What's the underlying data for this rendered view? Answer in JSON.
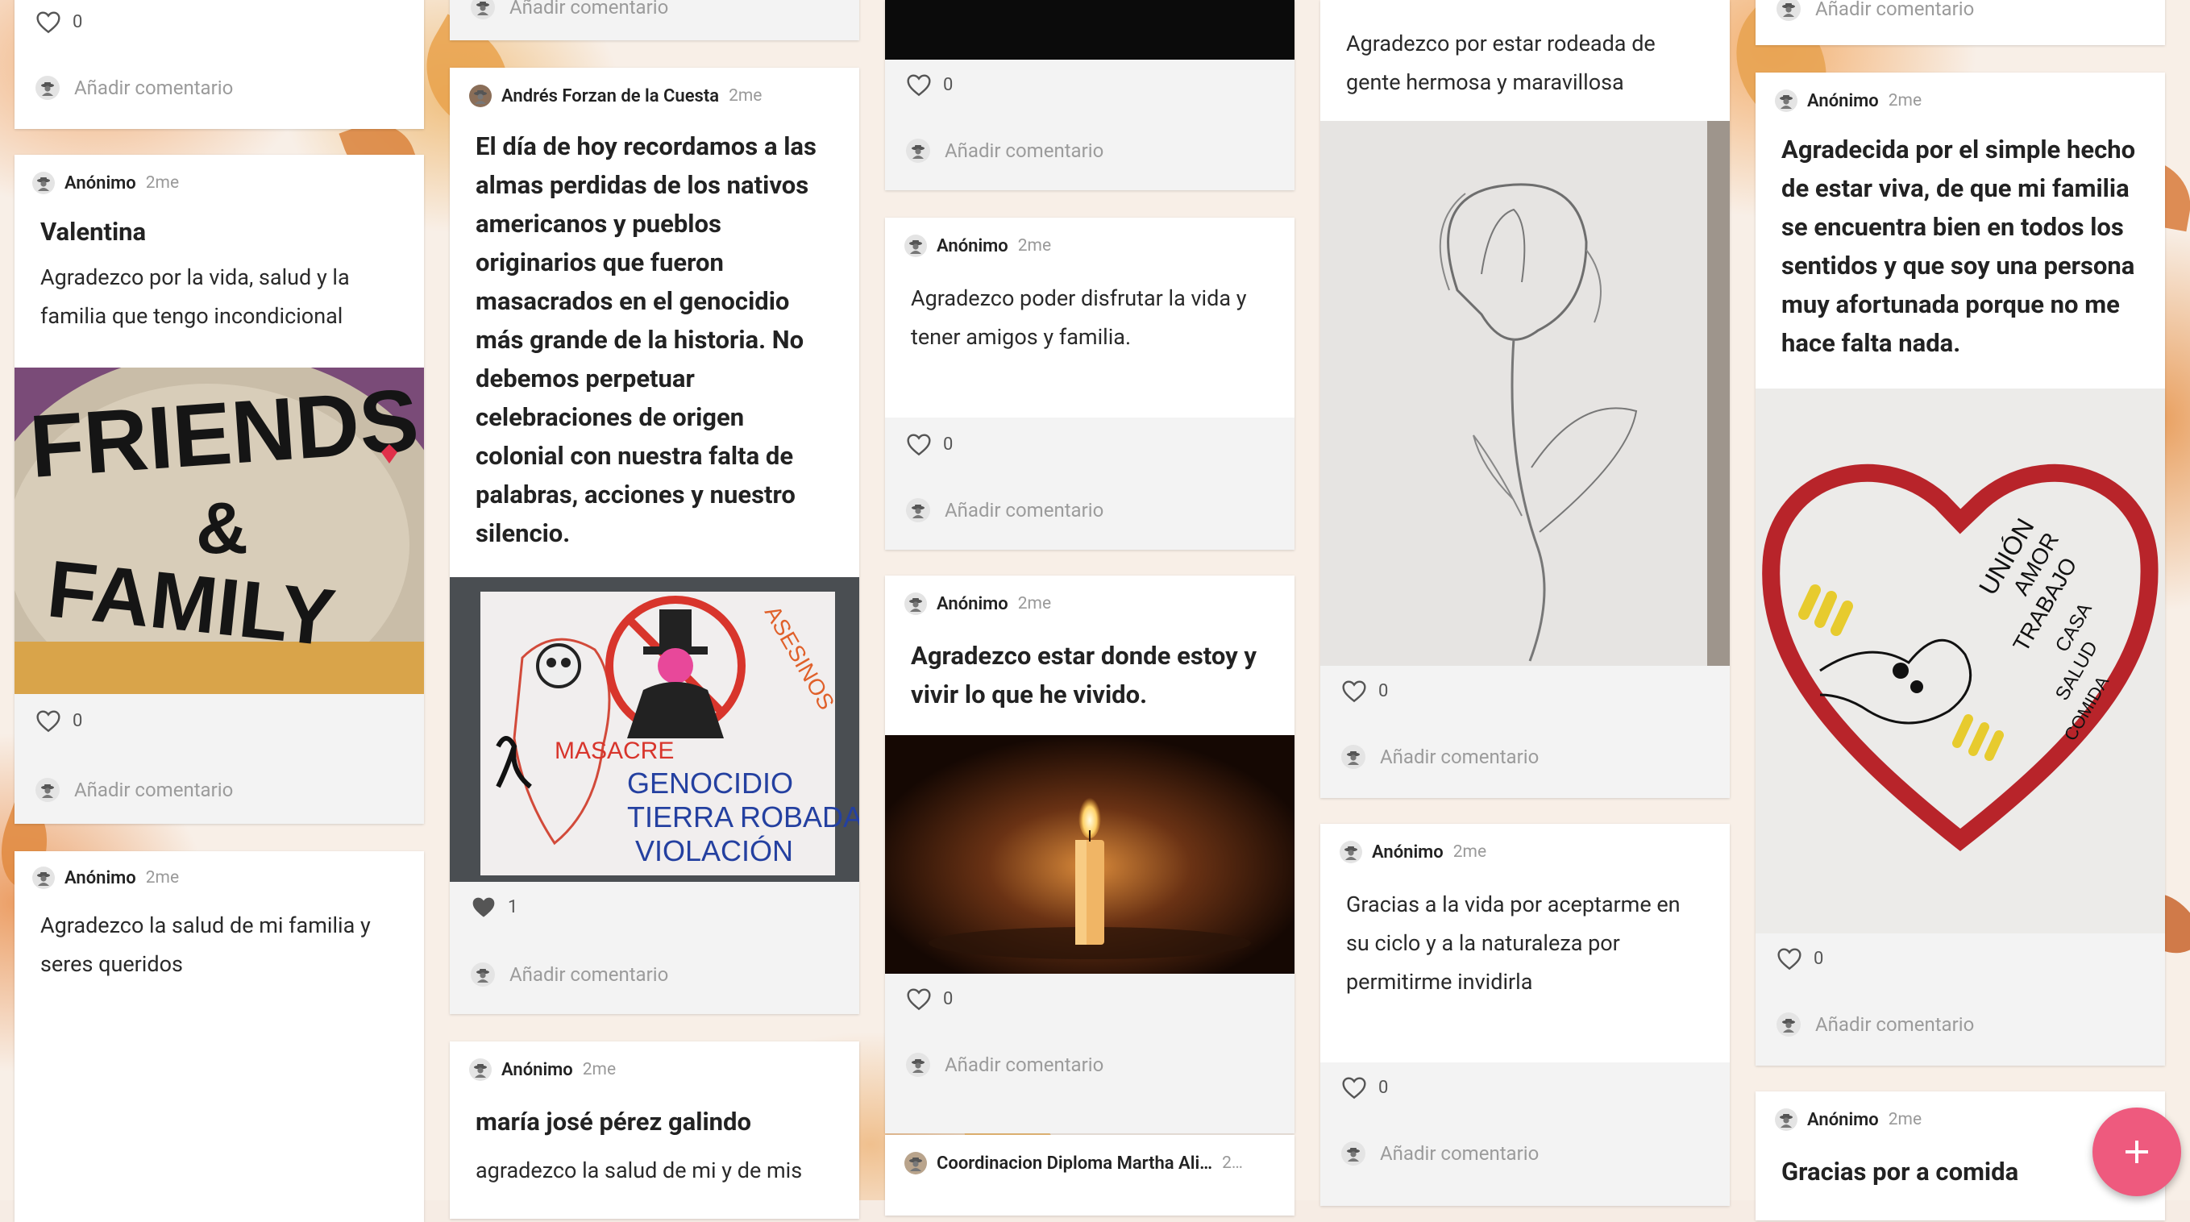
{
  "common": {
    "add_comment": "Añadir comentario"
  },
  "col1": {
    "c0": {
      "likes": "0"
    },
    "c1": {
      "author": "Anónimo",
      "time": "2me",
      "title": "Valentina",
      "body": "Agradezco por la vida, salud  y la familia que tengo incondicional",
      "likes": "0",
      "image": "friends-family-painted-stone"
    },
    "c2": {
      "author": "Anónimo",
      "time": "2me",
      "body": "Agradezco la salud de mi familia y seres queridos"
    }
  },
  "col2": {
    "c1": {
      "author": "Andrés Forzan de la Cuesta",
      "time": "2me",
      "title": "El día de hoy recordamos a las almas perdidas de los nativos americanos y pueblos originarios que fueron masacrados en el genocidio más grande de la historia. No debemos perpetuar celebraciones de origen colonial con nuestra falta de palabras, acciones y nuestro silencio.",
      "likes": "1",
      "image": "genocide-protest-poster",
      "poster_text": [
        "ASESINOS",
        "MASACRE",
        "GENOCIDIO",
        "TIERRA ROBADA",
        "VIOLACIÓN"
      ]
    },
    "c2": {
      "author": "Anónimo",
      "time": "2me",
      "title": "maría josé pérez galindo",
      "body": "agradezco la salud de mi y de mis"
    }
  },
  "col3": {
    "c0": {
      "likes": "0"
    },
    "c1": {
      "author": "Anónimo",
      "time": "2me",
      "body": "Agradezco poder disfrutar la vida y tener amigos y familia.",
      "likes": "0"
    },
    "c2": {
      "author": "Anónimo",
      "time": "2me",
      "title": "Agradezco estar donde estoy y vivir lo que he vivido.",
      "likes": "0",
      "image": "lit-candle"
    },
    "c3": {
      "author": "Coordinacion Diploma Martha Ali…",
      "time": "2…"
    }
  },
  "col4": {
    "c0": {
      "body": "Agradezco por estar rodeada de gente hermosa y maravillosa",
      "likes": "0",
      "image": "calla-lily-pencil-sketch"
    },
    "c1": {
      "author": "Anónimo",
      "time": "2me",
      "body": "Gracias a la vida por aceptarme en su ciclo y a la naturaleza por permitirme invidirla",
      "likes": "0"
    }
  },
  "col5": {
    "c1": {
      "author": "Anónimo",
      "time": "2me",
      "title": "Agradecida por el simple hecho de estar viva, de que mi familia se encuentra bien en todos los sentidos y que soy una persona muy afortunada porque no me hace falta nada.",
      "likes": "0",
      "image": "heart-drawing-handshake",
      "heart_text": [
        "UNIÓN",
        "AMOR",
        "TRABAJO",
        "CASA",
        "SALUD",
        "COMIDA"
      ]
    },
    "c2": {
      "author": "Anónimo",
      "time": "2me",
      "title": "Gracias por a comida"
    }
  },
  "fab": {
    "label": "+"
  },
  "colors": {
    "accent": "#ee5a7e",
    "footer": "#f3f3f3"
  }
}
